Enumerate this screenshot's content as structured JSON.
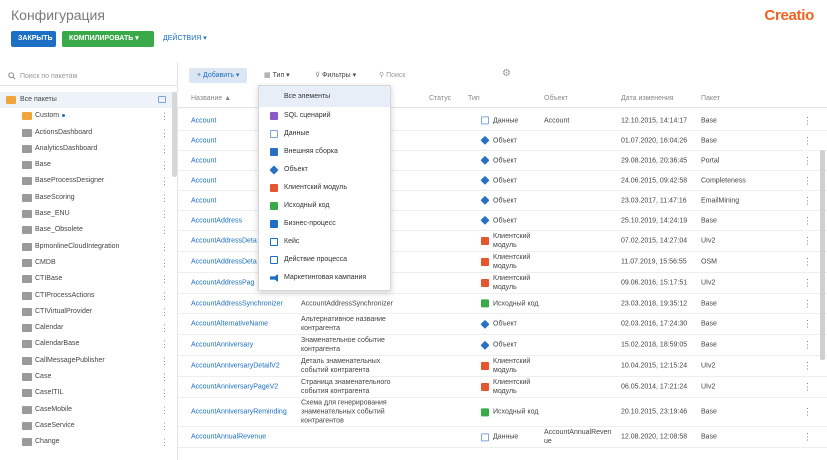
{
  "header": {
    "title": "Конфигурация",
    "logo": "Creatio",
    "close_label": "ЗАКРЫТЬ",
    "compile_label": "КОМПИЛИРОВАТЬ ▾",
    "actions_label": "ДЕЙСТВИЯ ▾"
  },
  "left": {
    "search_placeholder": "Поиск по пакетам",
    "all_packages": "Все пакеты",
    "packages": [
      "Custom",
      "ActionsDashboard",
      "AnalyticsDashboard",
      "Base",
      "BaseProcessDesigner",
      "BaseScoring",
      "Base_ENU",
      "Base_Obsolete",
      "BpmonlineCloudIntegration",
      "CMDB",
      "CTIBase",
      "CTIProcessActions",
      "CTIVirtualProvider",
      "Calendar",
      "CalendarBase",
      "CallMessagePublisher",
      "Case",
      "CaseITIL",
      "CaseMobile",
      "CaseService",
      "Change"
    ]
  },
  "toolbar": {
    "add_label": "+ Добавить ▾",
    "type_label": "Тип ▾",
    "filter_label": "Фильтры ▾",
    "search_placeholder": "Поиск"
  },
  "table": {
    "headers": {
      "name": "Название ▲",
      "status": "Статус",
      "type": "Тип",
      "object": "Объект",
      "date": "Дата изменения",
      "package": "Пакет"
    },
    "rows": [
      {
        "name": "Account",
        "title": "",
        "type": "Данные",
        "icon": "data",
        "object": "Account",
        "date": "12.10.2015, 14:14:17",
        "package": "Base"
      },
      {
        "name": "Account",
        "title": "",
        "type": "Объект",
        "icon": "obj",
        "object": "",
        "date": "01.07.2020, 16:04:26",
        "package": "Base"
      },
      {
        "name": "Account",
        "title": "",
        "type": "Объект",
        "icon": "obj",
        "object": "",
        "date": "29.08.2016, 20:36:45",
        "package": "Portal"
      },
      {
        "name": "Account",
        "title": "",
        "type": "Объект",
        "icon": "obj",
        "object": "",
        "date": "24.06.2015, 09:42:58",
        "package": "Completeness"
      },
      {
        "name": "Account",
        "title": "",
        "type": "Объект",
        "icon": "obj",
        "object": "",
        "date": "23.03.2017, 11:47:16",
        "package": "EmailMining"
      },
      {
        "name": "AccountAddress",
        "title": "",
        "type": "Объект",
        "icon": "obj",
        "object": "",
        "date": "25.10.2019, 14:24:19",
        "package": "Base"
      },
      {
        "name": "AccountAddressDeta",
        "title": "",
        "type": "Клиентский модуль",
        "icon": "client",
        "object": "",
        "date": "07.02.2015, 14:27:04",
        "package": "UIv2"
      },
      {
        "name": "AccountAddressDeta",
        "title": "",
        "type": "Клиентский модуль",
        "icon": "client",
        "object": "",
        "date": "11.07.2019, 15:56:55",
        "package": "OSM"
      },
      {
        "name": "AccountAddressPag",
        "title": "",
        "type": "Клиентский модуль",
        "icon": "client",
        "object": "",
        "date": "09.06.2016, 15:17:51",
        "package": "UIv2"
      },
      {
        "name": "AccountAddressSynchronizer",
        "title": "AccountAddressSynchronizer",
        "type": "Исходный код",
        "icon": "src",
        "object": "",
        "date": "23.03.2018, 19:35:12",
        "package": "Base"
      },
      {
        "name": "AccountAlternativeName",
        "title": "Альтернативное название контрагента",
        "type": "Объект",
        "icon": "obj",
        "object": "",
        "date": "02.03.2016, 17:24:30",
        "package": "Base"
      },
      {
        "name": "AccountAnniversary",
        "title": "Знаменательное событие контрагента",
        "type": "Объект",
        "icon": "obj",
        "object": "",
        "date": "15.02.2018, 18:59:05",
        "package": "Base"
      },
      {
        "name": "AccountAnniversaryDetailV2",
        "title": "Деталь знаменательных событий контрагента",
        "type": "Клиентский модуль",
        "icon": "client",
        "object": "",
        "date": "10.04.2015, 12:15:24",
        "package": "UIv2"
      },
      {
        "name": "AccountAnniversaryPageV2",
        "title": "Страница знаменательного события контрагента",
        "type": "Клиентский модуль",
        "icon": "client",
        "object": "",
        "date": "06.05.2014, 17:21:24",
        "package": "UIv2"
      },
      {
        "name": "AccountAnniversaryReminding",
        "title": "Схема для генерирования знаменательных событий контрагентов",
        "type": "Исходный код",
        "icon": "src",
        "object": "",
        "date": "20.10.2015, 23:19:46",
        "package": "Base"
      },
      {
        "name": "AccountAnnualRevenue",
        "title": "",
        "type": "Данные",
        "icon": "data",
        "object": "AccountAnnualReven ue",
        "date": "12.08.2020, 12:08:58",
        "package": "Base"
      }
    ]
  },
  "dropdown": {
    "items": [
      {
        "label": "Все элементы",
        "icon": ""
      },
      {
        "label": "SQL сценарий",
        "icon": "sql"
      },
      {
        "label": "Данные",
        "icon": "data"
      },
      {
        "label": "Внешняя сборка",
        "icon": "ext"
      },
      {
        "label": "Объект",
        "icon": "obj"
      },
      {
        "label": "Клиентский модуль",
        "icon": "client"
      },
      {
        "label": "Исходный код",
        "icon": "src"
      },
      {
        "label": "Бизнес-процесс",
        "icon": "bp"
      },
      {
        "label": "Кейс",
        "icon": "case"
      },
      {
        "label": "Действие процесса",
        "icon": "pa"
      },
      {
        "label": "Маркетинговая кампания",
        "icon": "mkt"
      }
    ]
  },
  "colors": {
    "accent": "#1c6fc4",
    "compile": "#3aa94a",
    "brand": "#f06221"
  }
}
